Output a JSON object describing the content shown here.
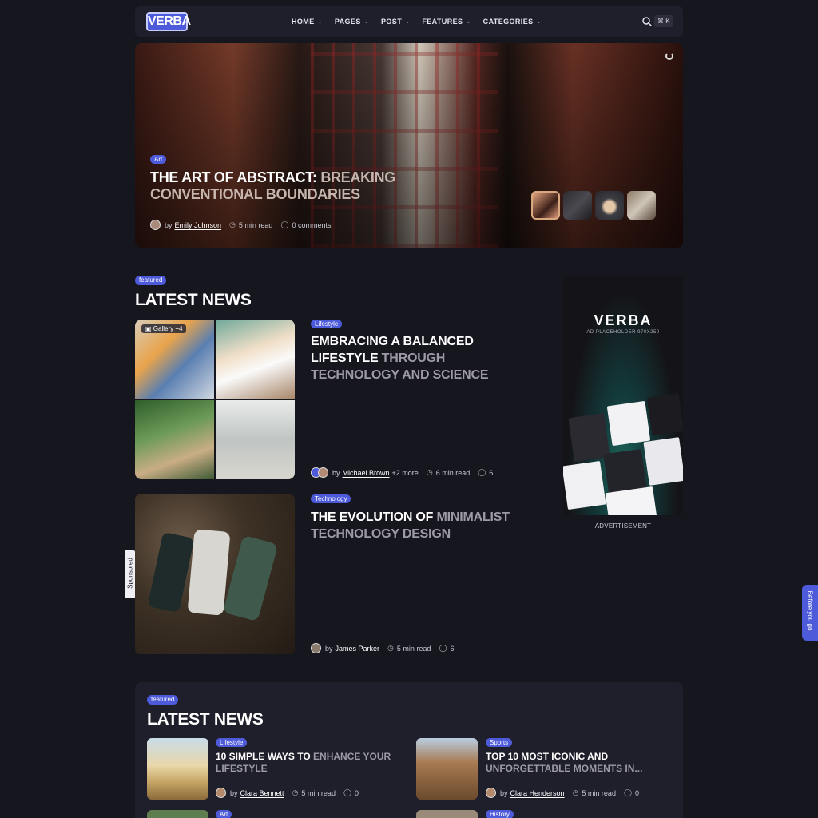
{
  "brand": {
    "logo_text": "VERBA"
  },
  "nav": {
    "items": [
      {
        "label": "HOME"
      },
      {
        "label": "PAGES"
      },
      {
        "label": "POST"
      },
      {
        "label": "FEATURES"
      },
      {
        "label": "CATEGORIES"
      }
    ],
    "search_shortcut": "⌘ K"
  },
  "hero": {
    "tag": "Art",
    "title_strong": "THE ART OF ABSTRACT:",
    "title_dim": " BREAKING CONVENTIONAL BOUNDARIES",
    "author_prefix": "by",
    "author": "Emily Johnson",
    "read_time": "5 min read",
    "comments": "0 comments"
  },
  "latest_news": {
    "badge": "featured",
    "title": "LATEST NEWS",
    "posts": [
      {
        "gallery_label": "Gallery",
        "gallery_count": "+4",
        "tag": "Lifestyle",
        "title_strong": "EMBRACING A BALANCED LIFESTYLE",
        "title_dim": " THROUGH TECHNOLOGY AND SCIENCE",
        "author_prefix": "by",
        "author": "Michael Brown",
        "more_authors": "+2 more",
        "read_time": "6 min read",
        "comments": "6"
      },
      {
        "tag": "Technology",
        "title_strong": "THE EVOLUTION OF",
        "title_dim": " MINIMALIST TECHNOLOGY DESIGN",
        "author_prefix": "by",
        "author": "James Parker",
        "read_time": "5 min read",
        "comments": "6"
      }
    ]
  },
  "sponsored_label": "Sponsored",
  "ad": {
    "logo": "VERBA",
    "sub": "AD PLACEHOLDER 970X250",
    "caption": "ADVERTISEMENT"
  },
  "side_tab": "Before you go",
  "latest_news_2": {
    "badge": "featured",
    "title": "LATEST NEWS",
    "posts": [
      {
        "tag": "Lifestyle",
        "title_strong": "10 SIMPLE WAYS TO",
        "title_dim": " ENHANCE YOUR LIFESTYLE",
        "author_prefix": "by",
        "author": "Clara Bennett",
        "read_time": "5 min read",
        "comments": "0"
      },
      {
        "tag": "Sports",
        "title_strong": "TOP 10 MOST ICONIC AND",
        "title_dim": " UNFORGETTABLE MOMENTS IN...",
        "author_prefix": "by",
        "author": "Clara Henderson",
        "read_time": "5 min read",
        "comments": "0"
      },
      {
        "tag": "Art"
      },
      {
        "tag": "History"
      }
    ]
  },
  "colors": {
    "accent": "#4d5ad9",
    "background": "#16161f",
    "panel": "#1f1f2b"
  }
}
